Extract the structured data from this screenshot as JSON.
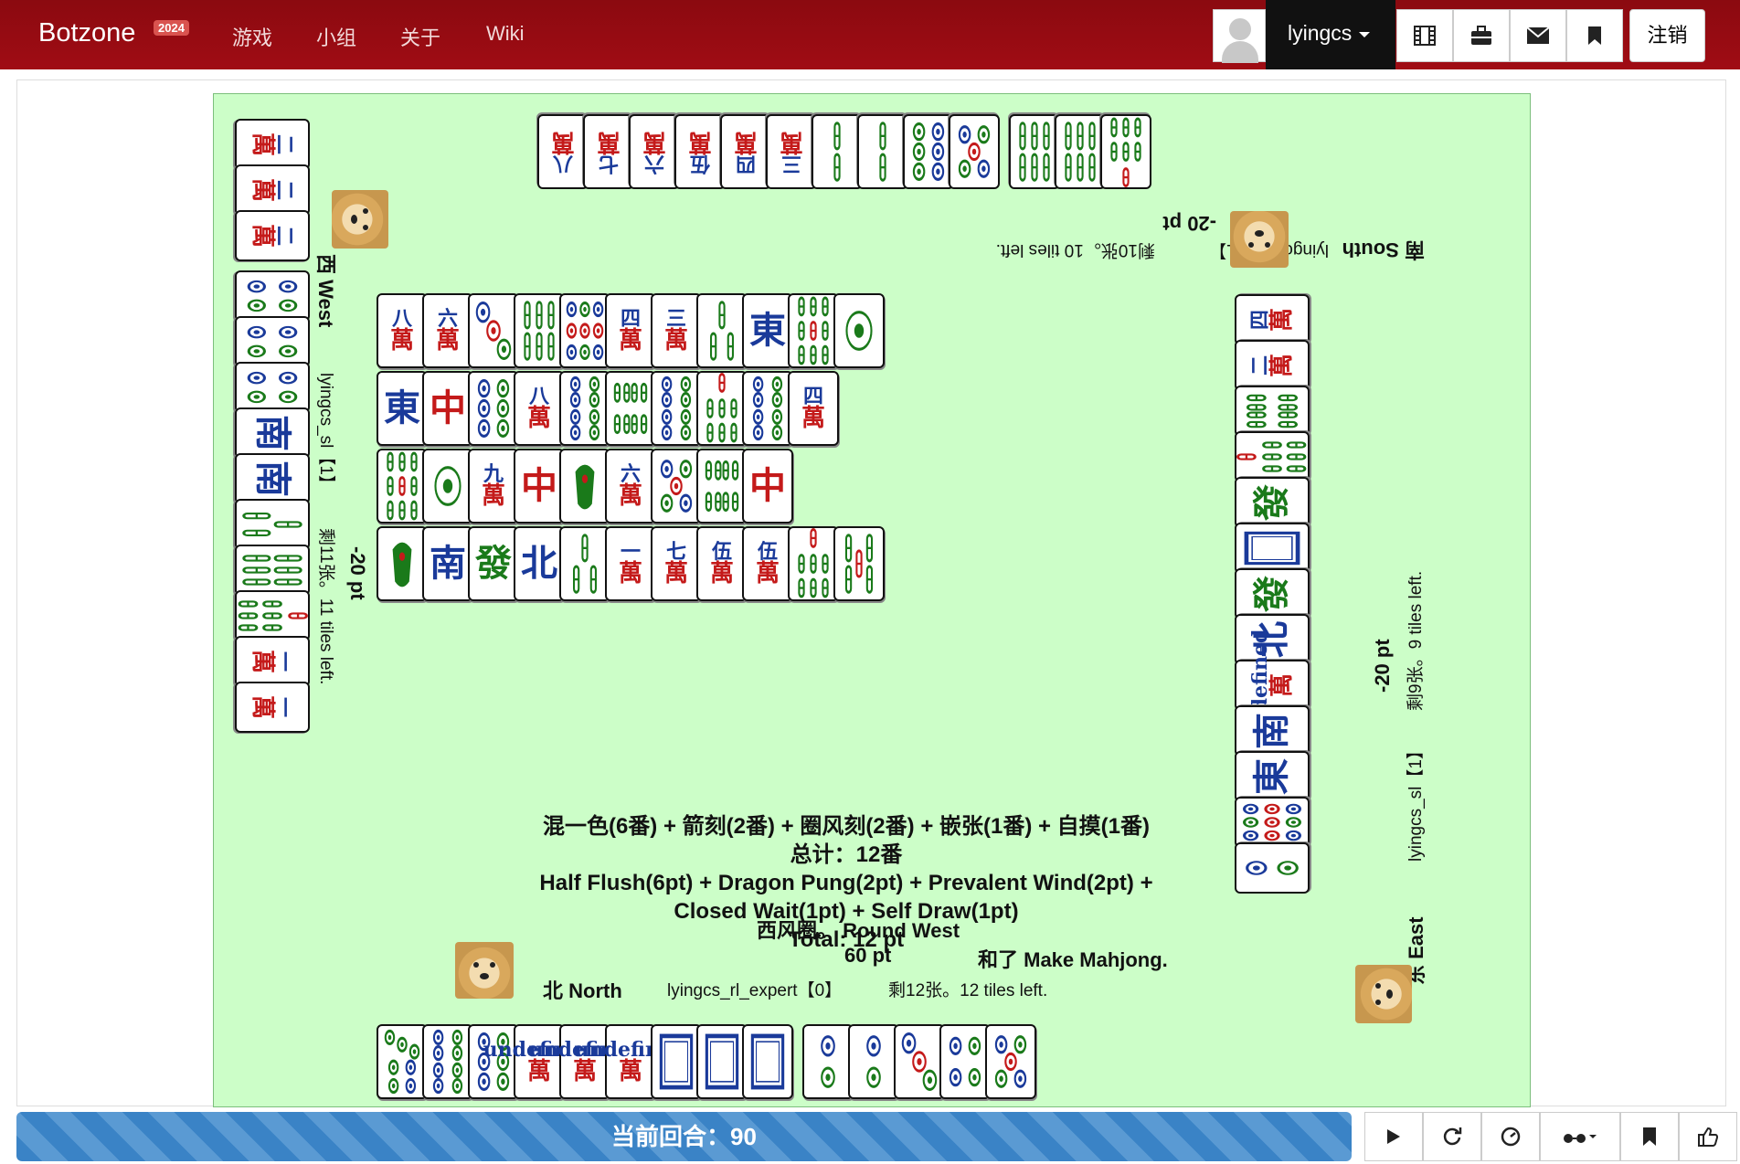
{
  "navbar": {
    "brand": "Botzone",
    "year_badge": "2024",
    "links": [
      "游戏",
      "小组",
      "关于",
      "Wiki"
    ],
    "username": "lyingcs",
    "icon_buttons": [
      "film-icon",
      "briefcase-icon",
      "envelope-icon",
      "bookmark-icon"
    ],
    "logout": "注销"
  },
  "colors": {
    "red": "#c41a1a",
    "green": "#1a7a1a",
    "blue": "#1a3a9a",
    "board": "#ccfec8",
    "navbar": "#8b0a10"
  },
  "players": {
    "south": {
      "seat": "南 South",
      "name": "lyingcs_sl【1】",
      "remaining": "剩10张。10 tiles left.",
      "score": "-20 pt"
    },
    "west": {
      "seat": "西 West",
      "name": "lyingcs_sl【1】",
      "remaining": "剩11张。11 tiles left.",
      "score": "-20 pt"
    },
    "east": {
      "seat": "东 East",
      "name": "lyingcs_sl【1】",
      "remaining": "剩9张。9 tiles left.",
      "score": "-20 pt"
    },
    "north": {
      "seat": "北 North",
      "name": "lyingcs_rl_expert【0】",
      "remaining": "剩12张。12 tiles left.",
      "score": "60 pt",
      "result": "和了 Make Mahjong."
    }
  },
  "round": "西风圈。 Round West",
  "fan": {
    "cn": "混一色(6番) + 箭刻(2番) + 圈风刻(2番) + 嵌张(1番) + 自摸(1番)",
    "cn_total": "总计：12番",
    "en1": "Half Flush(6pt) + Dragon Pung(2pt) + Prevalent Wind(2pt) +",
    "en2": "Closed Wait(1pt) + Self Draw(1pt)",
    "en_total": "Total: 12 pt"
  },
  "tiles": {
    "south_hand": [
      "W8",
      "W7",
      "W6",
      "W5",
      "W4",
      "W3",
      "T2",
      "T2",
      "B6",
      "B5",
      "T6",
      "T6",
      "T7"
    ],
    "west_hand": [
      "W2",
      "W2",
      "W2",
      "B4",
      "B4",
      "B4",
      "S",
      "S",
      "T3",
      "T6",
      "T7",
      "W1",
      "W1"
    ],
    "east_hand": [
      "W4",
      "W2",
      "T8",
      "T7",
      "F",
      "P",
      "F",
      "N",
      "Wx",
      "S",
      "E",
      "B9",
      "B2"
    ],
    "north_hand": [
      "B7",
      "B8",
      "B6",
      "Wx",
      "Wx",
      "Wx",
      "P",
      "P",
      "P",
      "B2",
      "B2",
      "B3",
      "B4",
      "B5"
    ],
    "discards": [
      [
        "W8",
        "W6",
        "B3",
        "T6",
        "B9",
        "W4",
        "W3",
        "T3",
        "E",
        "T9",
        "B1"
      ],
      [
        "E",
        "Z",
        "B6",
        "W8",
        "B8",
        "T8",
        "B8",
        "T7",
        "B8",
        "W4"
      ],
      [
        "T9",
        "B1",
        "W9",
        "Z",
        "T1",
        "W6",
        "B5",
        "T8",
        "Z"
      ],
      [
        "T1",
        "S",
        "F",
        "N",
        "T3",
        "W1",
        "W7",
        "W5",
        "W5",
        "T7",
        "T5"
      ]
    ]
  },
  "footer": {
    "turn_label": "当前回合：90",
    "controls": [
      "play-icon",
      "refresh-icon",
      "speed-icon",
      "view-icon",
      "bookmark-icon",
      "thumbs-up-icon"
    ]
  }
}
